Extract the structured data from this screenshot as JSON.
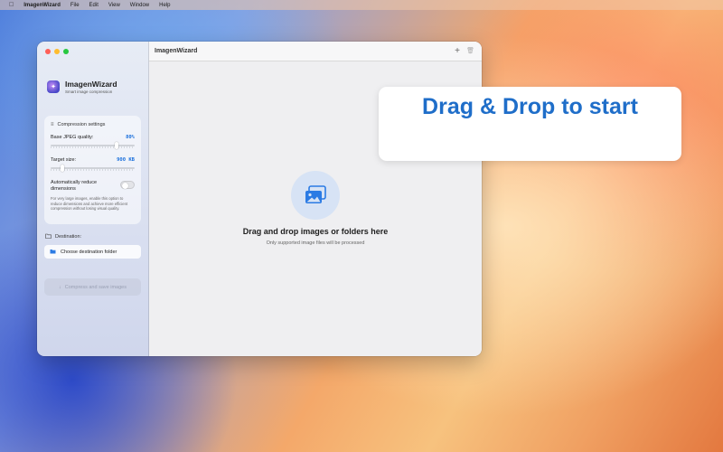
{
  "menubar": {
    "apple": "",
    "app_name": "ImagenWizard",
    "items": [
      "File",
      "Edit",
      "View",
      "Window",
      "Help"
    ]
  },
  "window": {
    "title": "ImagenWizard"
  },
  "sidebar": {
    "brand_name": "ImagenWizard",
    "brand_subtitle": "Smart image compression",
    "settings": {
      "heading": "Compression settings",
      "jpeg_label": "Base JPEG quality:",
      "jpeg_value": "80%",
      "jpeg_fraction": 0.8,
      "target_label": "Target size:",
      "target_value": "900 KB",
      "target_fraction": 0.12,
      "toggle_label": "Automatically reduce dimensions",
      "toggle_on": false,
      "note": "For very large images, enable this option to reduce dimensions and achieve more efficient compression without losing visual quality."
    },
    "destination": {
      "heading": "Destination:",
      "button_label": "Choose destination folder"
    },
    "compress_button": "Compress and save images"
  },
  "main": {
    "drop_title": "Drag and drop images or folders here",
    "drop_subtitle": "Only supported image files will be processed"
  },
  "callout": {
    "text": "Drag & Drop to start"
  },
  "colors": {
    "accent": "#1a6fdc",
    "callout_text": "#1f6ec9"
  }
}
